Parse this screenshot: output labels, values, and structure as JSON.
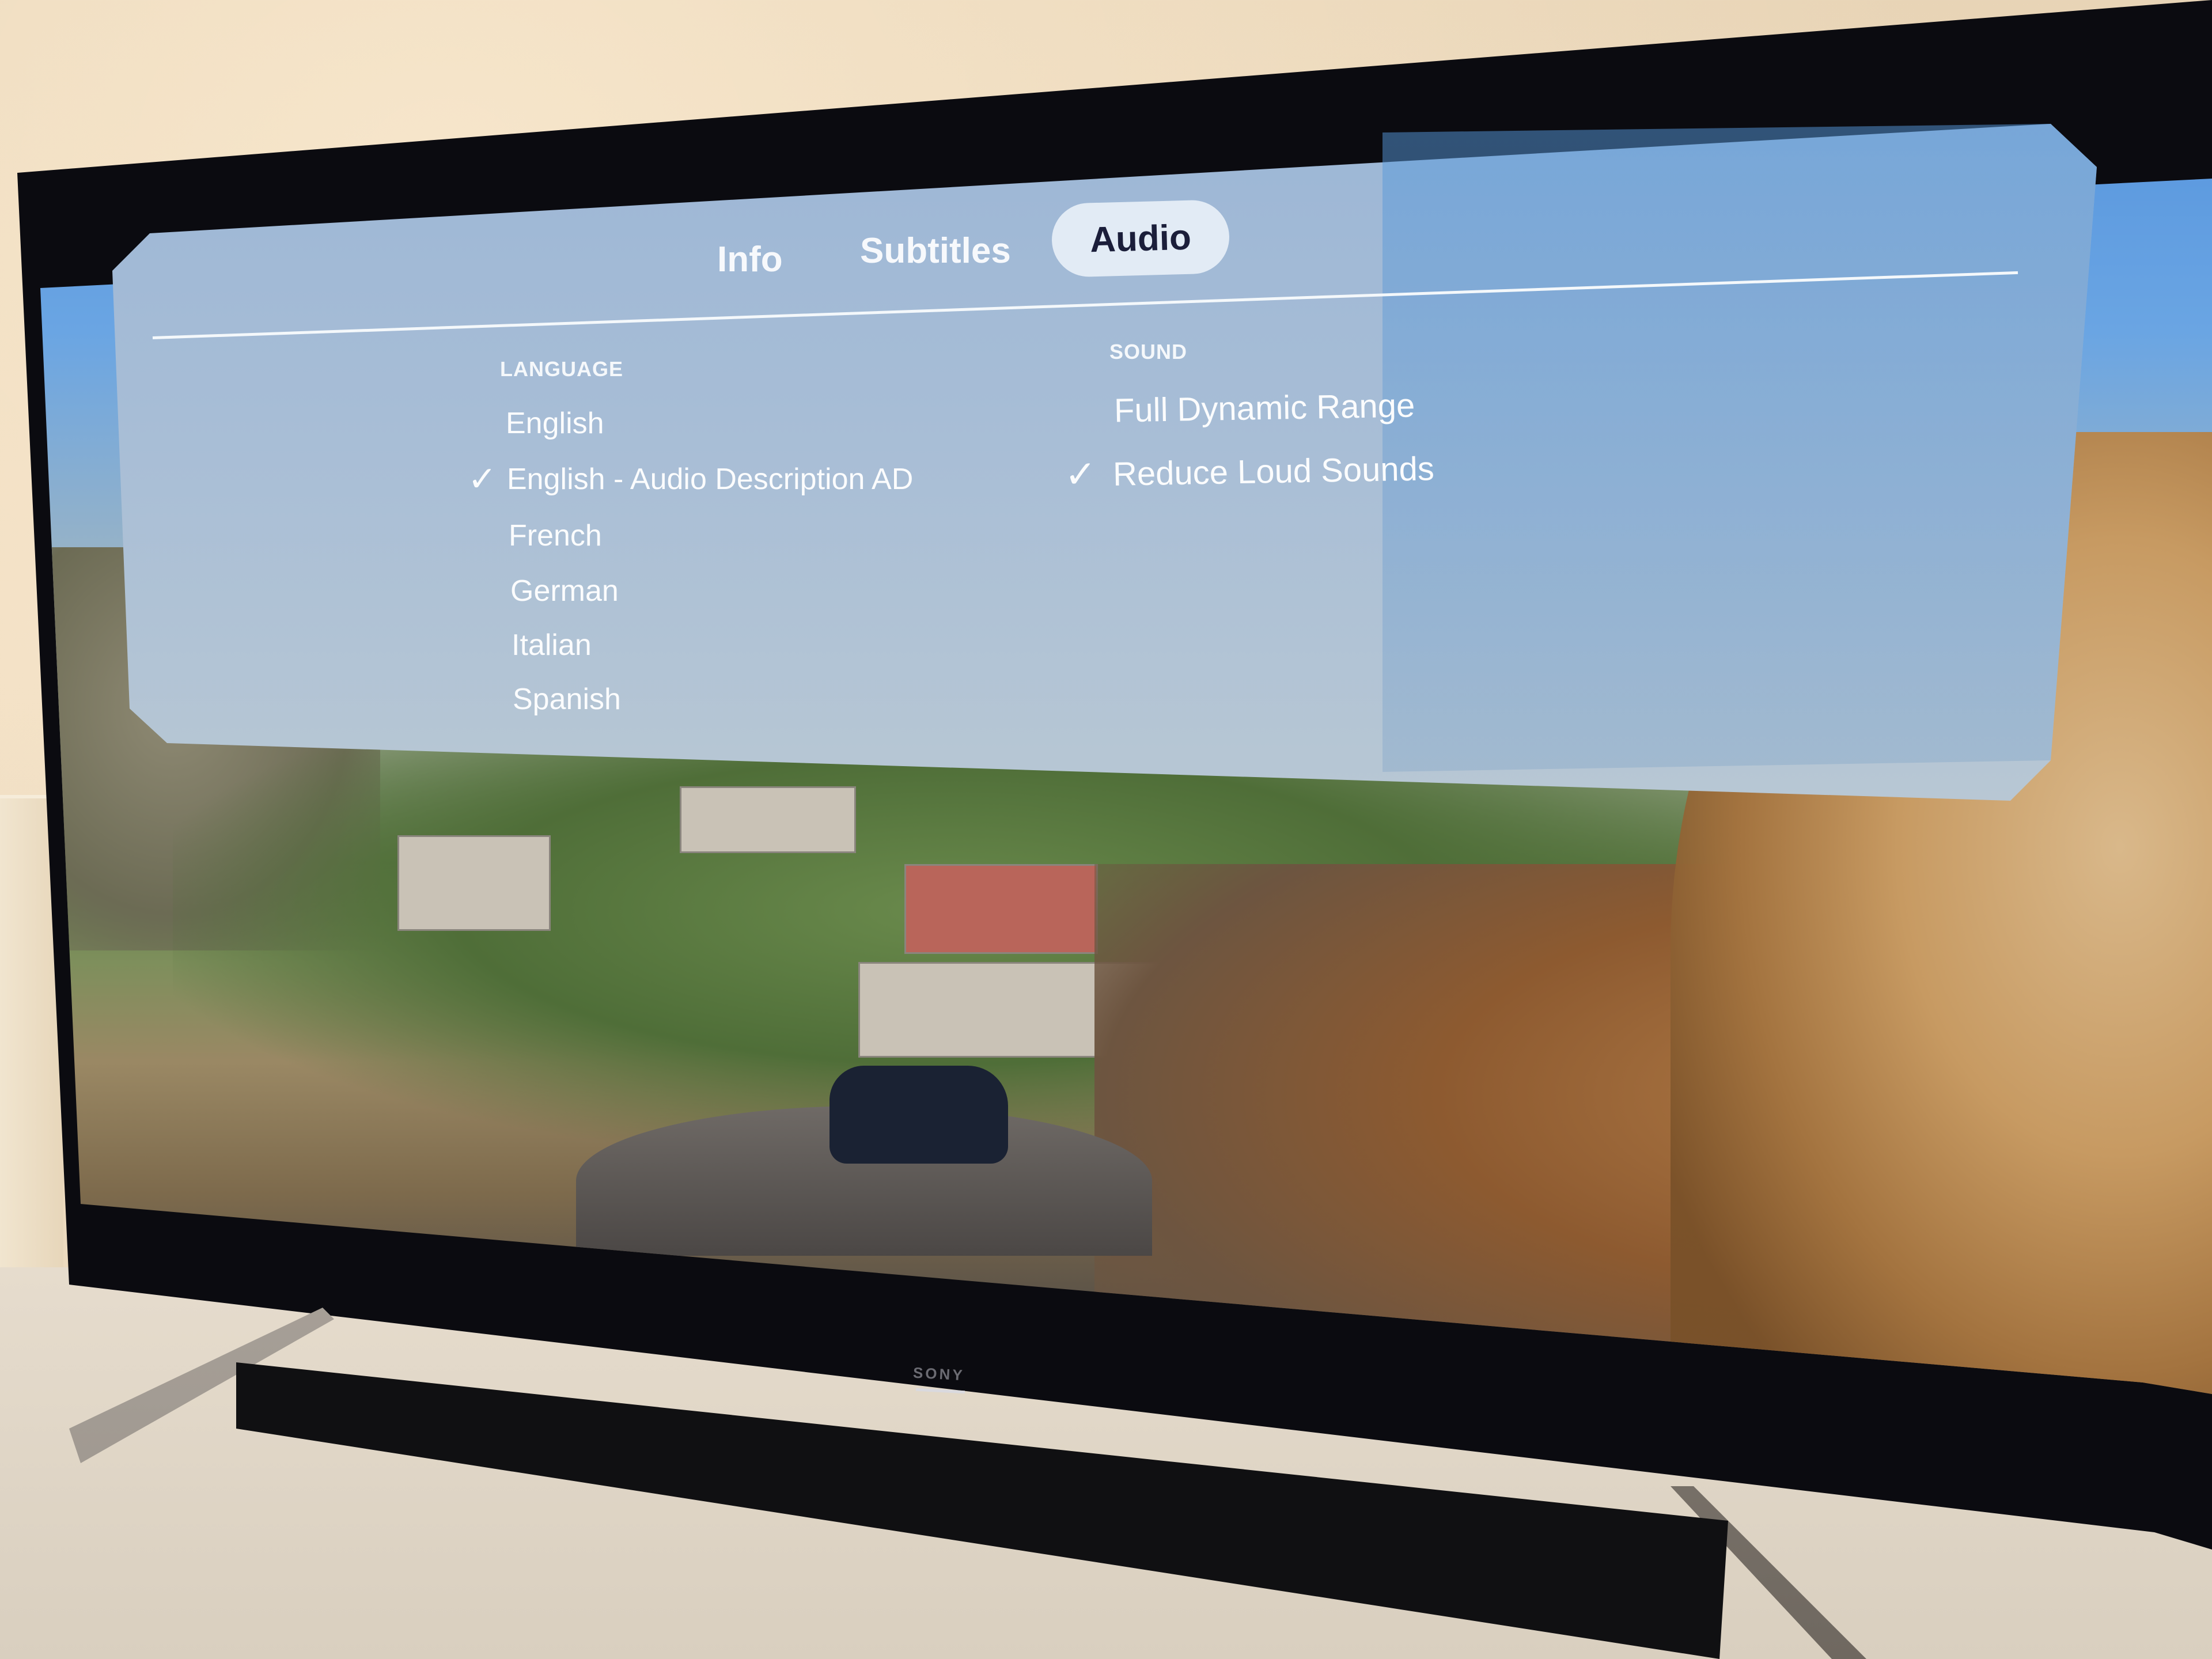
{
  "device": {
    "brand_label": "SONY"
  },
  "overlay": {
    "tabs": [
      {
        "label": "Info",
        "selected": false
      },
      {
        "label": "Subtitles",
        "selected": false
      },
      {
        "label": "Audio",
        "selected": true
      }
    ],
    "language": {
      "header": "LANGUAGE",
      "options": [
        {
          "label": "English",
          "checked": false
        },
        {
          "label": "English - Audio Description AD",
          "checked": true
        },
        {
          "label": "French",
          "checked": false
        },
        {
          "label": "German",
          "checked": false
        },
        {
          "label": "Italian",
          "checked": false
        },
        {
          "label": "Spanish",
          "checked": false
        }
      ]
    },
    "sound": {
      "header": "SOUND",
      "options": [
        {
          "label": "Full Dynamic Range",
          "checked": false
        },
        {
          "label": "Reduce Loud Sounds",
          "checked": true
        }
      ]
    },
    "check_glyph": "✓"
  },
  "colors": {
    "panel_tint": "#a7bdd6",
    "selected_tab_bg": "#e2ebf5",
    "selected_tab_text": "#1b1e3a",
    "text": "#fbfcfd"
  }
}
